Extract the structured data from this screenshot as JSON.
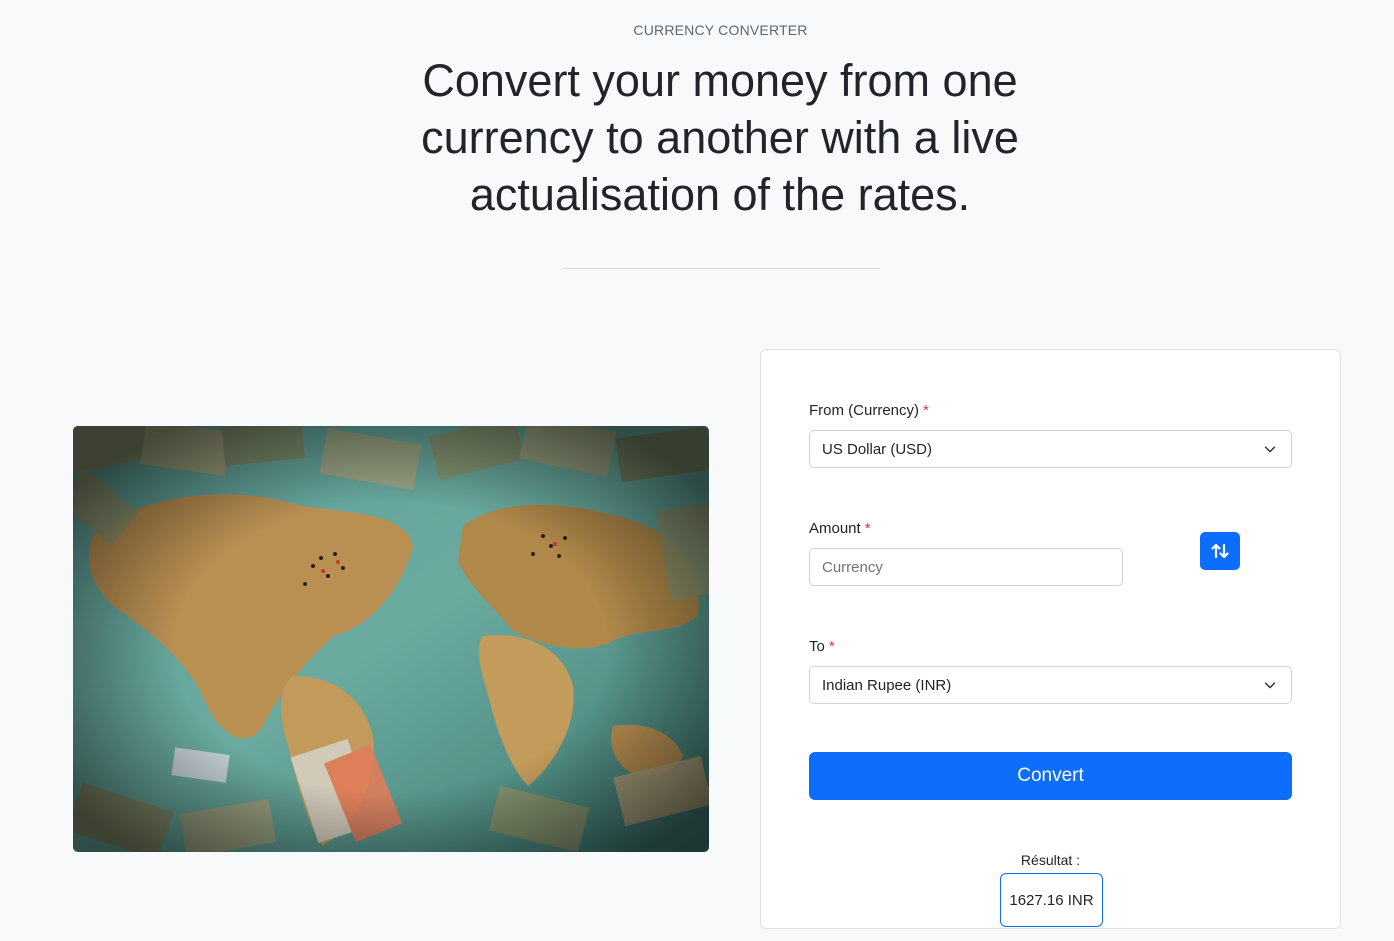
{
  "hero": {
    "eyebrow": "CURRENCY CONVERTER",
    "headline": "Convert your money from one currency to another with a live actualisation of the rates."
  },
  "image": {
    "subject": "world-map-with-banknotes"
  },
  "form": {
    "from_label": "From (Currency)",
    "from_value": "US Dollar (USD)",
    "amount_label": "Amount",
    "amount_placeholder": "Currency",
    "amount_value": "",
    "to_label": "To",
    "to_value": "Indian Rupee (INR)",
    "required_mark": "*",
    "convert_label": "Convert",
    "result_label": "Résultat :",
    "result_value": "1627.16 INR"
  },
  "icons": {
    "swap": "swap-vertical-icon",
    "chevron": "chevron-down-icon"
  },
  "colors": {
    "primary": "#0d6efd",
    "required": "#dc3545",
    "background": "#f8f9fa"
  }
}
